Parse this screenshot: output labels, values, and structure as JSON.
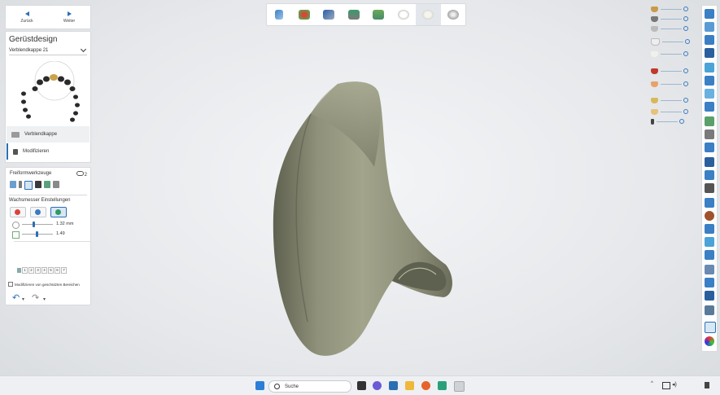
{
  "nav": {
    "back_label": "Zurück",
    "next_label": "Weiter"
  },
  "panel": {
    "title": "Gerüstdesign",
    "selector_value": "Verblendkappe 21",
    "steps": [
      {
        "label": "Verblendkappe",
        "icon": "framework-icon"
      },
      {
        "label": "Modifizieren",
        "icon": "modify-icon"
      }
    ]
  },
  "tools": {
    "title": "Freiformwerkzeuge",
    "count": "2",
    "section_title": "Wachsmesser Einstellungen",
    "modes": [
      "add-mode",
      "remove-mode",
      "smooth-mode"
    ],
    "sliders": [
      {
        "value": "1.32 mm",
        "level": 0.35
      },
      {
        "value": "1.49",
        "level": 0.45
      }
    ],
    "presets": [
      "1",
      "2",
      "3",
      "4",
      "5",
      "6",
      "7"
    ],
    "checkbox_label": "Modifizieren von geschützten Bereichen"
  },
  "toolbar": {
    "buttons": [
      "scan-tool",
      "prep-tool",
      "abutment-tool",
      "model-tool",
      "gingiva-tool",
      "tooth-tool",
      "cap-tool",
      "sphere-tool"
    ],
    "active_index": 6
  },
  "colors": {
    "accent": "#2b6fb3",
    "model": "#8a8c72"
  },
  "taskbar": {
    "search_placeholder": "Suche"
  }
}
